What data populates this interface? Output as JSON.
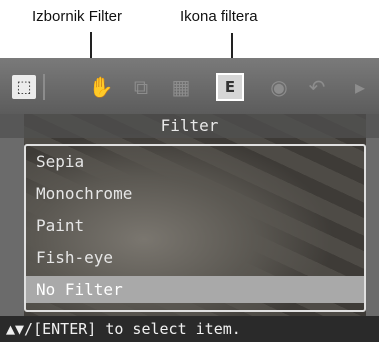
{
  "callouts": {
    "filter_menu": "Izbornik Filter",
    "filter_icon": "Ikona filtera"
  },
  "toolbar": {
    "icons": [
      "select-icon",
      "hand-icon",
      "rotate-icon",
      "adjust-icon",
      "filter-icon",
      "redeye-icon",
      "undo-icon",
      "next-arrow-icon"
    ]
  },
  "menu": {
    "title": "Filter",
    "items": [
      "Sepia",
      "Monochrome",
      "Paint",
      "Fish-eye",
      "No Filter"
    ],
    "selected": "No Filter"
  },
  "status": "▲▼/[ENTER] to select item."
}
